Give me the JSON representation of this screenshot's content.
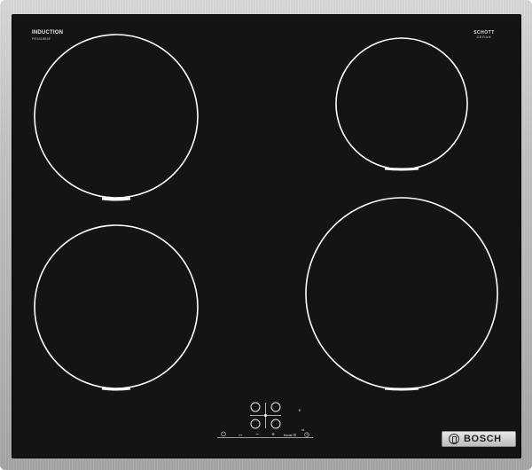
{
  "cooktop": {
    "type_label": "INDUCTION",
    "model_label": "PIE631BB5E",
    "glass_brand_line1": "SCHOTT",
    "glass_brand_line2": "CERAN",
    "glass_brand_line3": "",
    "brand": "BOSCH"
  },
  "controls": {
    "power_symbol": "⏻",
    "lock_symbol": "⊶",
    "minus_symbol": "−",
    "plus_symbol": "+",
    "boost_label": "boost ⊡",
    "timer_symbol": "◷",
    "display_symbol": "88",
    "zone_indicator": "E"
  },
  "colors": {
    "glass": "#141414",
    "frame": "#c2c2c2",
    "ring": "#ffffff"
  }
}
